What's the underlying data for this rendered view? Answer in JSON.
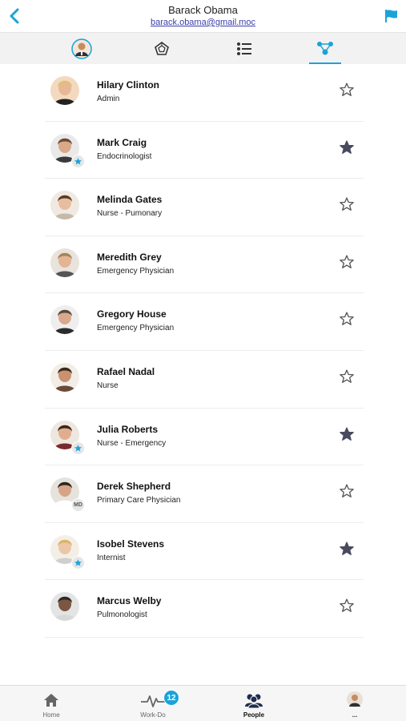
{
  "header": {
    "title": "Barack Obama",
    "email": "barack.obama@gmail.moc",
    "accent": "#1aa3d9"
  },
  "tabs": [
    {
      "name": "profile",
      "icon": "avatar-icon"
    },
    {
      "name": "pentagon",
      "icon": "pentagon-icon"
    },
    {
      "name": "list",
      "icon": "list-icon"
    },
    {
      "name": "team",
      "icon": "team-network-icon",
      "active": true
    }
  ],
  "contacts": [
    {
      "name": "Hilary Clinton",
      "role": "Admin",
      "starred": false,
      "badge": ""
    },
    {
      "name": "Mark Craig",
      "role": "Endocrinologist",
      "starred": true,
      "badge": "star"
    },
    {
      "name": "Melinda Gates",
      "role": "Nurse - Pumonary",
      "starred": false,
      "badge": ""
    },
    {
      "name": "Meredith Grey",
      "role": "Emergency Physician",
      "starred": false,
      "badge": ""
    },
    {
      "name": "Gregory House",
      "role": "Emergency Physician",
      "starred": false,
      "badge": ""
    },
    {
      "name": "Rafael Nadal",
      "role": "Nurse",
      "starred": false,
      "badge": ""
    },
    {
      "name": "Julia Roberts",
      "role": "Nurse - Emergency",
      "starred": true,
      "badge": "star"
    },
    {
      "name": "Derek Shepherd",
      "role": "Primary Care Physician",
      "starred": false,
      "badge": "MD"
    },
    {
      "name": "Isobel Stevens",
      "role": "Internist",
      "starred": true,
      "badge": "star"
    },
    {
      "name": "Marcus Welby",
      "role": "Pulmonologist",
      "starred": false,
      "badge": ""
    }
  ],
  "bottom_nav": {
    "home_label": "Home",
    "workdo_label": "Work-Do",
    "workdo_count": "12",
    "people_label": "People",
    "more_label": "..."
  }
}
